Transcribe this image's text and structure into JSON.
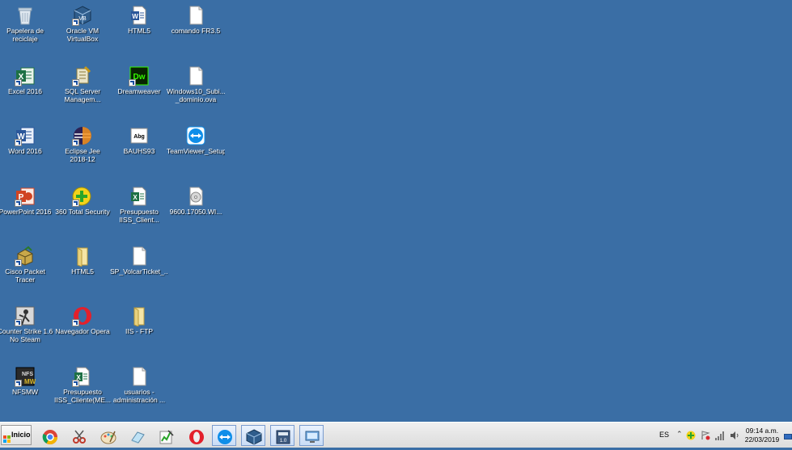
{
  "desktop": {
    "background_color": "#3a6ea5",
    "icons": [
      {
        "label": "Papelera de\nreciclaje",
        "icon": "recycle-bin-icon"
      },
      {
        "label": "Oracle VM\nVirtualBox",
        "icon": "virtualbox-icon"
      },
      {
        "label": "HTML5",
        "icon": "word-doc-icon"
      },
      {
        "label": "comando FR3.5",
        "icon": "blank-file-icon"
      },
      {
        "label": "Excel 2016",
        "icon": "excel-icon"
      },
      {
        "label": "SQL Server\nManagem...",
        "icon": "sql-server-icon"
      },
      {
        "label": "Dreamweaver",
        "icon": "dreamweaver-icon"
      },
      {
        "label": "Windows10_Subi...\n_dominio.ova",
        "icon": "blank-file-icon"
      },
      {
        "label": "Word 2016",
        "icon": "word-icon"
      },
      {
        "label": "Eclipse Jee\n2018-12",
        "icon": "eclipse-icon"
      },
      {
        "label": "BAUHS93",
        "icon": "font-file-icon"
      },
      {
        "label": "TeamViewer_Setup",
        "icon": "teamviewer-icon"
      },
      {
        "label": "PowerPoint 2016",
        "icon": "powerpoint-icon"
      },
      {
        "label": "360 Total Security",
        "icon": "360-security-icon"
      },
      {
        "label": "Presupuesto\nIISS_Client...",
        "icon": "excel-file-icon"
      },
      {
        "label": "9600.17050.WI...",
        "icon": "disc-image-icon"
      },
      {
        "label": "Cisco Packet\nTracer",
        "icon": "cisco-packet-tracer-icon"
      },
      {
        "label": "HTML5",
        "icon": "folder-icon"
      },
      {
        "label": "SP_VolcarTicket_...",
        "icon": "blank-file-icon"
      },
      {
        "label": "Counter Strike 1.6\nNo Steam",
        "icon": "counter-strike-icon"
      },
      {
        "label": "Navegador Opera",
        "icon": "opera-icon"
      },
      {
        "label": "IIS - FTP",
        "icon": "folder-icon"
      },
      {
        "label": "NFSMW",
        "icon": "nfsmw-icon"
      },
      {
        "label": "Presupuesto\nIISS_Cliente(ME...",
        "icon": "excel-file-icon"
      },
      {
        "label": "usuarios -\nadministración ...",
        "icon": "blank-file-icon"
      }
    ]
  },
  "taskbar": {
    "start_label": "Inicio",
    "pinned": [
      {
        "name": "chrome",
        "icon": "chrome-icon"
      },
      {
        "name": "snipping-tool",
        "icon": "scissors-icon"
      },
      {
        "name": "paint",
        "icon": "paint-palette-icon"
      },
      {
        "name": "eraser",
        "icon": "eraser-icon"
      },
      {
        "name": "task-manager",
        "icon": "chart-icon"
      },
      {
        "name": "opera",
        "icon": "opera-icon"
      },
      {
        "name": "teamviewer",
        "icon": "teamviewer-icon"
      },
      {
        "name": "virtualbox",
        "icon": "virtualbox-icon"
      },
      {
        "name": "calculator",
        "icon": "calculator-icon"
      },
      {
        "name": "remote-desktop",
        "icon": "remote-desktop-icon"
      }
    ],
    "tray": {
      "language": "ES",
      "time": "09:14 a.m.",
      "date": "22/03/2019"
    }
  }
}
